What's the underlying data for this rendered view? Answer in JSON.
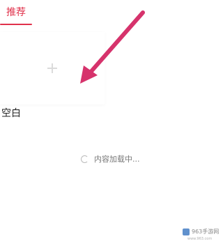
{
  "tabs": [
    {
      "label": "推荐",
      "active": true
    }
  ],
  "colors": {
    "accent": "#e0314b",
    "arrow": "#d6336c",
    "watermark_logo": "#1e63b8"
  },
  "template_card": {
    "icon": "plus-icon",
    "label": "空白"
  },
  "loading": {
    "text": "内容加载中..."
  },
  "watermark": {
    "text": "963手游网",
    "sub": "www.963.com"
  }
}
